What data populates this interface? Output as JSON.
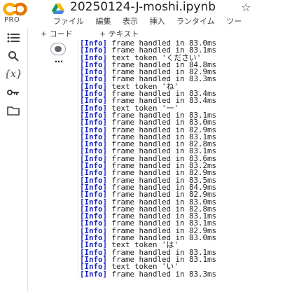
{
  "app": {
    "logo_pro": "PRO",
    "title": "20250124-J-moshi.ipynb",
    "star": "☆",
    "menu": [
      "ファイル",
      "編集",
      "表示",
      "挿入",
      "ランタイム",
      "ツー"
    ]
  },
  "toolbar": {
    "code_label": "+ コード",
    "text_label": "+ テキスト"
  },
  "sidebar": {
    "items": [
      {
        "icon": "toc-icon",
        "glyph": "☰"
      },
      {
        "icon": "search-icon",
        "glyph": "⚲"
      },
      {
        "icon": "variables-icon",
        "glyph": "{x}"
      },
      {
        "icon": "key-icon",
        "glyph": "⚿"
      },
      {
        "icon": "folder-icon",
        "glyph": "▭"
      }
    ]
  },
  "cell": {
    "dots": "⋯",
    "lines": [
      {
        "tag": "[Info]",
        "text": " frame handled in 83.0ms"
      },
      {
        "tag": "[Info]",
        "text": " frame handled in 83.1ms"
      },
      {
        "tag": "[Info]",
        "text": " text token 'ください'"
      },
      {
        "tag": "[Info]",
        "text": " frame handled in 84.8ms"
      },
      {
        "tag": "[Info]",
        "text": " frame handled in 82.9ms"
      },
      {
        "tag": "[Info]",
        "text": " frame handled in 83.3ms"
      },
      {
        "tag": "[Info]",
        "text": " text token 'ね'"
      },
      {
        "tag": "[Info]",
        "text": " frame handled in 83.4ms"
      },
      {
        "tag": "[Info]",
        "text": " frame handled in 83.4ms"
      },
      {
        "tag": "[Info]",
        "text": " text token '一'"
      },
      {
        "tag": "[Info]",
        "text": " frame handled in 83.1ms"
      },
      {
        "tag": "[Info]",
        "text": " frame handled in 83.0ms"
      },
      {
        "tag": "[Info]",
        "text": " frame handled in 82.9ms"
      },
      {
        "tag": "[Info]",
        "text": " frame handled in 83.1ms"
      },
      {
        "tag": "[Info]",
        "text": " frame handled in 82.8ms"
      },
      {
        "tag": "[Info]",
        "text": " frame handled in 83.1ms"
      },
      {
        "tag": "[Info]",
        "text": " frame handled in 83.6ms"
      },
      {
        "tag": "[Info]",
        "text": " frame handled in 83.2ms"
      },
      {
        "tag": "[Info]",
        "text": " frame handled in 82.9ms"
      },
      {
        "tag": "[Info]",
        "text": " frame handled in 83.5ms"
      },
      {
        "tag": "[Info]",
        "text": " frame handled in 84.9ms"
      },
      {
        "tag": "[Info]",
        "text": " frame handled in 82.9ms"
      },
      {
        "tag": "[Info]",
        "text": " frame handled in 83.0ms"
      },
      {
        "tag": "[Info]",
        "text": " frame handled in 82.8ms"
      },
      {
        "tag": "[Info]",
        "text": " frame handled in 83.1ms"
      },
      {
        "tag": "[Info]",
        "text": " frame handled in 83.1ms"
      },
      {
        "tag": "[Info]",
        "text": " frame handled in 82.9ms"
      },
      {
        "tag": "[Info]",
        "text": " frame handled in 83.0ms"
      },
      {
        "tag": "[Info]",
        "text": " text token 'は'"
      },
      {
        "tag": "[Info]",
        "text": " frame handled in 83.1ms"
      },
      {
        "tag": "[Info]",
        "text": " frame handled in 83.1ms"
      },
      {
        "tag": "[Info]",
        "text": " text token 'い'"
      },
      {
        "tag": "[Info]",
        "text": " frame handled in 83.3ms"
      }
    ]
  },
  "colors": {
    "info_tag": "#1a25c9",
    "logo_orange": "#f9ab00",
    "logo_yellow": "#e37400"
  }
}
